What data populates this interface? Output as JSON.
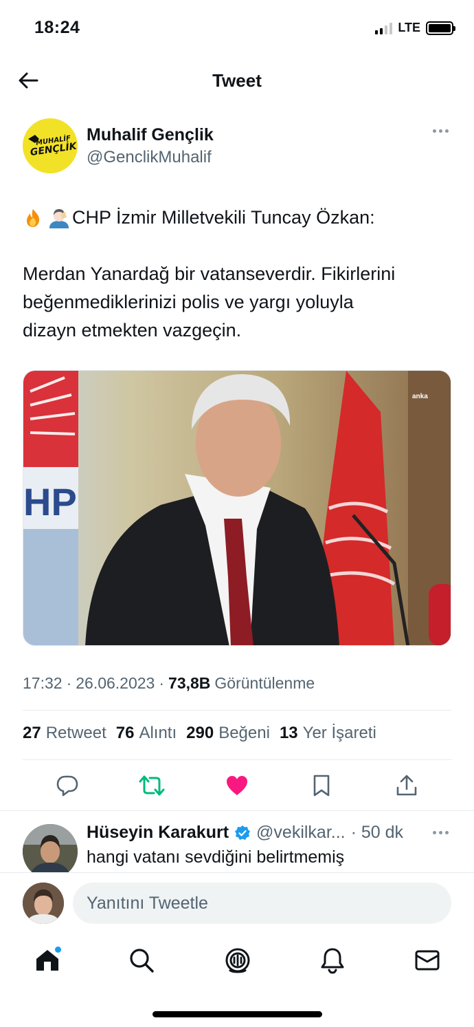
{
  "status_bar": {
    "time": "18:24",
    "network": "LTE",
    "signal_bars": 2,
    "battery_level": 1.0
  },
  "nav": {
    "title": "Tweet",
    "back_icon": "arrow-left-icon"
  },
  "tweet": {
    "author_name": "Muhalif Gençlik",
    "author_handle": "@GenclikMuhalif",
    "avatar_text": "MUHALİF GENÇLİK",
    "emojis": [
      "fire-emoji",
      "facepalm-emoji"
    ],
    "headline": "CHP İzmir Milletvekili Tuncay Özkan:",
    "body_lines": [
      "Merdan Yanardağ bir vatanseverdir. Fikirlerini",
      "beğenmediklerinizi polis ve yargı yoluyla",
      "dizayn etmekten vazgeçin."
    ],
    "media_watermark": "anka",
    "media_sign_text": "HP",
    "time": "17:32",
    "date": "26.06.2023",
    "views": "73,8B",
    "views_label": "Görüntülenme",
    "stats": [
      {
        "count": "27",
        "label": "Retweet"
      },
      {
        "count": "76",
        "label": "Alıntı"
      },
      {
        "count": "290",
        "label": "Beğeni"
      },
      {
        "count": "13",
        "label": "Yer İşareti"
      }
    ],
    "actions": [
      "reply-icon",
      "retweet-icon",
      "like-icon",
      "bookmark-icon",
      "share-icon"
    ],
    "colors": {
      "retweet": "#00ba7c",
      "like": "#f91880",
      "text_secondary": "#536471",
      "accent": "#1d9bf0"
    }
  },
  "reply": {
    "name": "Hüseyin Karakurt",
    "handle": "@vekilkar...",
    "time": "· 50 dk",
    "text": "hangi vatanı sevdiğini belirtmemiş"
  },
  "composer": {
    "placeholder": "Yanıtını Tweetle"
  },
  "tab_bar": {
    "items": [
      "home-icon",
      "search-icon",
      "spaces-icon",
      "notifications-icon",
      "messages-icon"
    ]
  }
}
